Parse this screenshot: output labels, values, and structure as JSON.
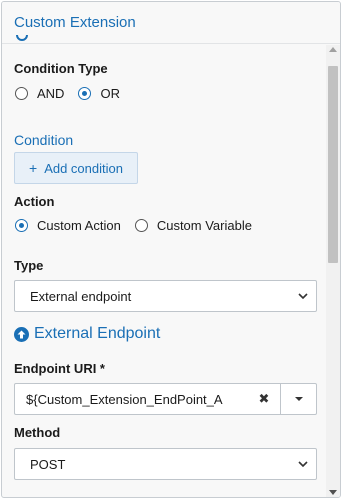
{
  "header": {
    "title": "Custom Extension"
  },
  "condition_type": {
    "label": "Condition Type",
    "options": [
      "AND",
      "OR"
    ],
    "selected": "OR"
  },
  "condition": {
    "title": "Condition",
    "add_label": "Add condition",
    "add_icon": "plus-icon"
  },
  "action": {
    "label": "Action",
    "options": [
      "Custom Action",
      "Custom Variable"
    ],
    "selected": "Custom Action"
  },
  "type": {
    "label": "Type",
    "value": "External endpoint"
  },
  "external_endpoint": {
    "title": "External Endpoint",
    "icon": "arrow-up-circle-icon",
    "uri_label": "Endpoint URI *",
    "uri_value": "${Custom_Extension_EndPoint_A"
  },
  "method": {
    "label": "Method",
    "value": "POST"
  },
  "colors": {
    "accent": "#1a6fb5",
    "button_bg": "#e8f0f8"
  }
}
